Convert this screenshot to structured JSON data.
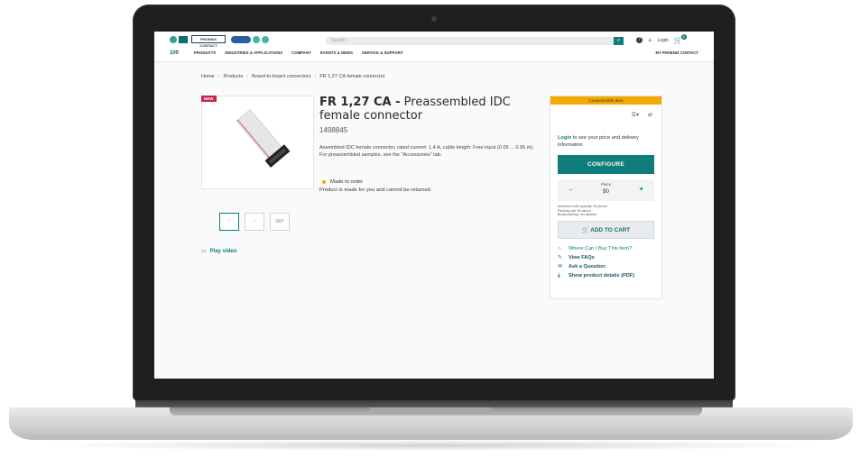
{
  "site": {
    "logo_text": "PHOENIX CONTACT",
    "search_placeholder": "Search",
    "login_label": "Login",
    "cart_count": "1",
    "brand_tag": "100",
    "nav": [
      "PRODUCTS",
      "INDUSTRIES & APPLICATIONS",
      "COMPANY",
      "EVENTS & NEWS",
      "SERVICE & SUPPORT"
    ],
    "my_account": "MY PHOENIX CONTACT"
  },
  "breadcrumb": [
    "Home",
    "Products",
    "Board-to-board connectors",
    "FR 1,27 CA female connector"
  ],
  "product": {
    "badge": "NEW",
    "title_bold": "FR 1,27 CA -",
    "title_rest": " Preassembled IDC female connector",
    "number": "1498845",
    "description": "Assembled IDC female connector, rated current: 1.4 A, cable length: Free input (0.05 ... 0.95 m). For preassembled samples, see the \"Accessories\" tab.",
    "availability": "Made to order",
    "return_note": "Product is made for you and cannot be returned.",
    "thumbnails": [
      "",
      "",
      "360°"
    ],
    "play_video": "Play video"
  },
  "panel": {
    "customizable": "Customizable Item",
    "login_link": "Login",
    "login_rest": " to see your price and delivery information",
    "configure": "CONFIGURE",
    "qty_label": "Piece",
    "qty_value": "$0",
    "min_info": [
      "Minimum order quantity: 50 pieces",
      "Packing unit: 50 pieces",
      "Break packing: not allowed"
    ],
    "add_to_cart": "ADD TO CART",
    "links": [
      {
        "label": "Where Can I Buy This Item?",
        "icon": "store-icon"
      },
      {
        "label": "View FAQs",
        "icon": "faq-icon"
      },
      {
        "label": "Ask a Question",
        "icon": "chat-icon"
      },
      {
        "label": "Show product details (PDF)",
        "icon": "download-icon"
      }
    ]
  },
  "colors": {
    "accent": "#0e7d7b",
    "badge": "#c8254a",
    "customizable": "#f2a900"
  }
}
